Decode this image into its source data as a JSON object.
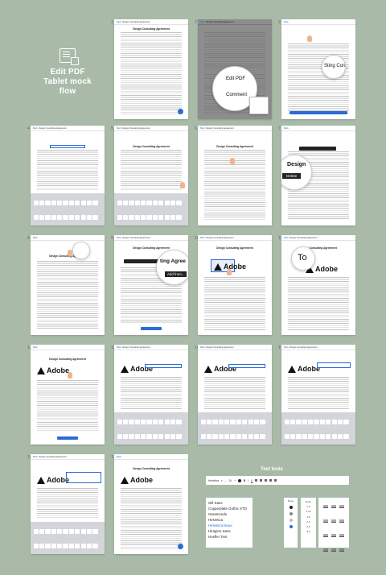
{
  "hero": {
    "title_line1": "Edit PDF",
    "title_line2": "Tablet mock flow"
  },
  "document": {
    "title": "Design Consulting Agreement",
    "back_label": "Back",
    "tab_label": "Design Consulting Agreement",
    "logo_text": "Adobe"
  },
  "frames": [
    {
      "number": "1"
    },
    {
      "number": "2"
    },
    {
      "number": "3"
    },
    {
      "number": "4"
    },
    {
      "number": "5"
    },
    {
      "number": "6"
    },
    {
      "number": "7"
    },
    {
      "number": "8"
    },
    {
      "number": "9"
    },
    {
      "number": "10"
    },
    {
      "number": "11"
    },
    {
      "number": "12"
    },
    {
      "number": "13"
    },
    {
      "number": "14"
    },
    {
      "number": "15"
    },
    {
      "number": "16"
    },
    {
      "number": "17"
    },
    {
      "number": "18"
    }
  ],
  "context_menu": {
    "edit_pdf": "Edit PDF",
    "comment": "Comment"
  },
  "callouts": {
    "ting_con": "Sting Con",
    "design": "Design",
    "delete": "Delete",
    "ting_agreement": "ting Agree",
    "add_from": "Add from...",
    "to": "To"
  },
  "text_tools": {
    "title": "Text tools",
    "font_family": "Helvetica",
    "font_size": "24",
    "fonts": [
      "Gill Sans",
      "Copperplate Gothic STD",
      "Garamonde",
      "Helvetica",
      "Helvetica Neue",
      "Hiragino Sans",
      "Hoefler Text"
    ],
    "selected_font": "Helvetica Neue",
    "size_header": "None",
    "spacing_header": "None",
    "spacing_values": [
      "1.0",
      "1.15",
      "1.5",
      "2.0",
      "2.5",
      "3.0"
    ]
  },
  "colors": {
    "background": "#a9bba8",
    "accent": "#2b6bd6"
  }
}
